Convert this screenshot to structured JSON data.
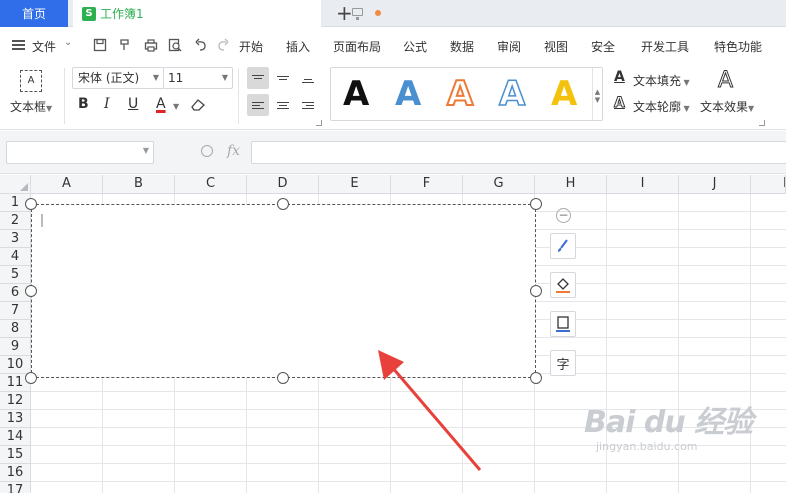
{
  "tabs": {
    "home": "首页",
    "document": {
      "icon_letter": "S",
      "title": "工作簿1"
    },
    "add": "+"
  },
  "menubar": {
    "file_label": "文件",
    "items": [
      "开始",
      "插入",
      "页面布局",
      "公式",
      "数据",
      "审阅",
      "视图",
      "安全",
      "开发工具",
      "特色功能"
    ]
  },
  "ribbon": {
    "textbox_icon": "A",
    "textbox_label": "文本框",
    "font_name": "宋体 (正文)",
    "font_size": "11",
    "bold": "B",
    "italic": "I",
    "underline": "U",
    "font_color": "A",
    "art_styles": [
      {
        "letter": "A",
        "color": "#111111"
      },
      {
        "letter": "A",
        "color": "#4a8fd0"
      },
      {
        "letter": "A",
        "color": "#ee7a36"
      },
      {
        "letter": "A",
        "color": "#4a8fd0"
      },
      {
        "letter": "A",
        "color": "#f4c20d"
      }
    ],
    "text_fill": "文本填充",
    "text_outline": "文本轮廓",
    "text_effect": "文本效果",
    "effect_icon": "A"
  },
  "formula_bar": {
    "name_box_value": "",
    "fx_label": "fx",
    "formula_value": ""
  },
  "sheet": {
    "columns": [
      "A",
      "B",
      "C",
      "D",
      "E",
      "F",
      "G",
      "H",
      "I",
      "J",
      "K"
    ],
    "rows": [
      "1",
      "2",
      "3",
      "4",
      "5",
      "6",
      "7",
      "8",
      "9",
      "10",
      "11",
      "12",
      "13",
      "14",
      "15",
      "16",
      "17"
    ]
  },
  "float_toolbar": {
    "collapse_symbol": "−",
    "wrap_icon_text": "字"
  },
  "watermark": {
    "main": "Bai du 经验",
    "sub": "jingyan.baidu.com"
  },
  "colors": {
    "accent": "#2f6ee8",
    "doc_green": "#2eb051",
    "arrow_red": "#e8403a",
    "font_color_red": "#e02424"
  },
  "icons": {
    "float_tools": [
      "brush-icon",
      "fill-bucket-icon",
      "shape-outline-icon",
      "text-wrap-icon"
    ]
  }
}
